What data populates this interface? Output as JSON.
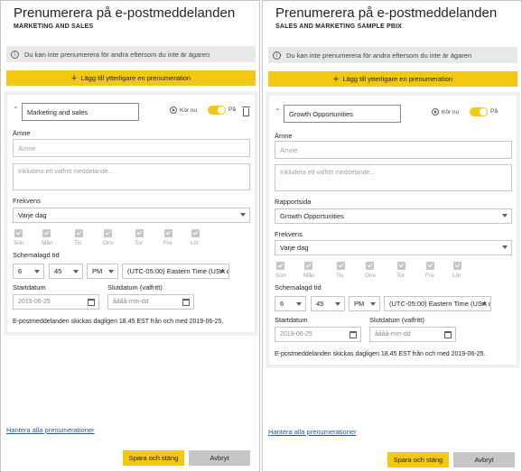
{
  "left": {
    "title": "Prenumerera på e-postmeddelanden",
    "subtitle": "MARKETING AND SALES",
    "info": "Du kan inte prenumerera för andra eftersom du inte är ägaren",
    "add_label": "Lägg till ytterligare en prenumeration",
    "subscription_name": "Marketing and sales",
    "run_now": "Kör nu",
    "toggle_label": "På",
    "subject_label": "Ämne",
    "subject_placeholder": "Ämne",
    "message_placeholder": "Inkludera ett valfritt meddelande...",
    "frequency_label": "Frekvens",
    "frequency_value": "Varje dag",
    "days": [
      "Sön",
      "Mån",
      "Tis",
      "Ons",
      "Tor",
      "Fre",
      "Lör"
    ],
    "schedule_label": "Schemalagd tid",
    "hour": "6",
    "minute": "45",
    "ampm": "PM",
    "timezone": "(UTC-05:00) Eastern Time (USA oc",
    "start_label": "Startdatum",
    "start_value": "2019-06-25",
    "end_label": "Slutdatum (valfritt)",
    "end_placeholder": "åååå-mm-dd",
    "note": "E-postmeddelanden skickas dagligen 18.45 EST från och med 2019-06-25.",
    "manage_link": "Hantera alla prenumerationer",
    "save_label": "Spara och stäng",
    "cancel_label": "Avbryt"
  },
  "right": {
    "title": "Prenumerera på e-postmeddelanden",
    "subtitle": "SALES AND MARKETING SAMPLE PBIX",
    "info": "Du kan inte prenumerera för andra eftersom du inte är ägaren",
    "add_label": "Lägg till ytterligare en prenumeration",
    "subscription_name": "Growth Opportunities",
    "run_now": "Kör nu",
    "toggle_label": "På",
    "subject_label": "Ämne",
    "subject_placeholder": "Ämne",
    "message_placeholder": "Inkludera ett valfritt meddelande...",
    "report_page_label": "Rapportsida",
    "report_page_value": "Growth Opportunities",
    "frequency_label": "Frekvens",
    "frequency_value": "Varje dag",
    "days": [
      "Sön",
      "Mån",
      "Tis",
      "Ons",
      "Tor",
      "Fre",
      "Lör"
    ],
    "schedule_label": "Schemalagd tid",
    "hour": "6",
    "minute": "45",
    "ampm": "PM",
    "timezone": "(UTC-05:00) Eastern Time (USA oc",
    "start_label": "Startdatum",
    "start_value": "2019-06-25",
    "end_label": "Slutdatum (valfritt)",
    "end_placeholder": "åååå-mm-dd",
    "note": "E-postmeddelanden skickas dagligen 18.45 EST från och med 2019-06-25.",
    "manage_link": "Hantera alla prenumerationer",
    "save_label": "Spara och stäng",
    "cancel_label": "Avbryt"
  },
  "colors": {
    "accent": "#f2c811",
    "link": "#2b579a",
    "disabled": "#c8c6c4"
  },
  "icons": [
    "info-icon",
    "plus-icon",
    "chevron-up-icon",
    "play-icon",
    "trash-icon",
    "calendar-icon",
    "chevron-down-icon",
    "checkmark-icon"
  ]
}
